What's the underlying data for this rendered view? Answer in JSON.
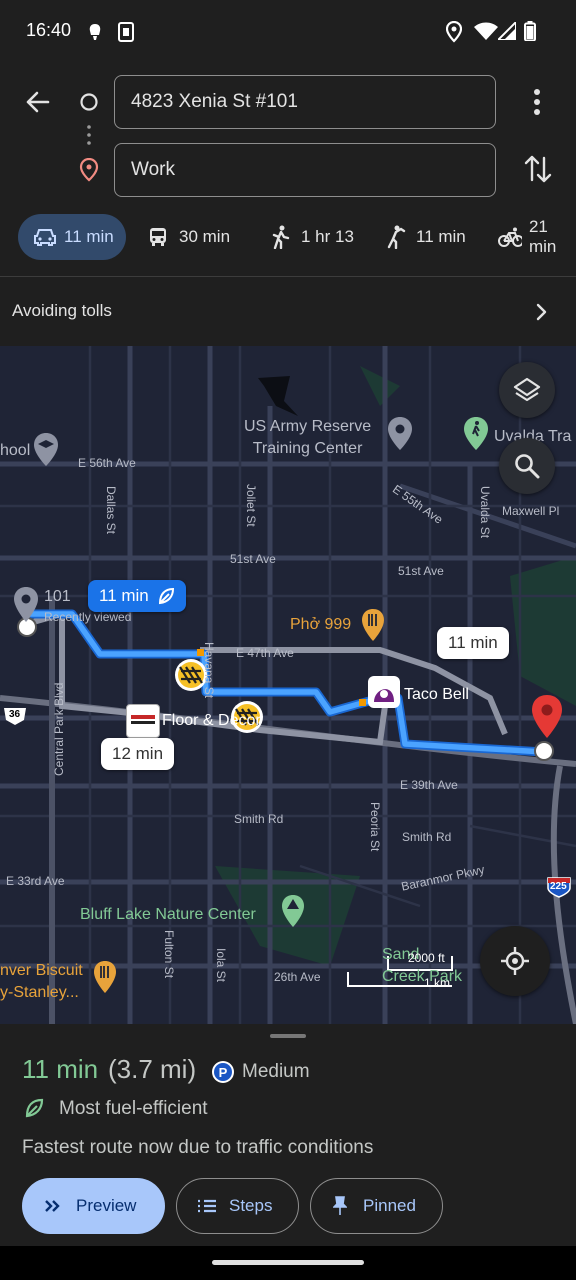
{
  "status": {
    "time": "16:40"
  },
  "directions": {
    "origin": "4823 Xenia St #101",
    "destination": "Work",
    "modes": [
      {
        "name": "drive",
        "label": "11 min"
      },
      {
        "name": "transit",
        "label": "30 min"
      },
      {
        "name": "walk",
        "label": "1 hr 13"
      },
      {
        "name": "rideshare",
        "label": "11 min"
      },
      {
        "name": "bike",
        "label": "21 min"
      }
    ],
    "options": "Avoiding tolls"
  },
  "map": {
    "labels": {
      "army": "US Army Reserve\nTraining Center",
      "uvalda": "Uvalda Tra",
      "school": "hool",
      "e56": "E 56th Ave",
      "dallas": "Dallas St",
      "joliet": "Joliet St",
      "e55": "E 55th Ave",
      "maxwell": "Maxwell Pl",
      "uvalda_st": "Uvalda St",
      "ave51_a": "51st Ave",
      "ave51_b": "51st Ave",
      "num101": "101",
      "recently": "Recently viewed",
      "pho": "Phở 999",
      "e47": "E 47th Ave",
      "havana": "Havana St",
      "tacobell": "Taco Bell",
      "floor": "Floor & Decor",
      "central": "Central Park Blvd",
      "hwy36": "36",
      "e39": "E 39th Ave",
      "smith1": "Smith Rd",
      "smith2": "Smith Rd",
      "peoria": "Peoria St",
      "barnmor": "Baranmor Pkwy",
      "e33": "E 33rd Ave",
      "i225": "225",
      "bluff": "Bluff Lake Nature Center",
      "fulton": "Fulton St",
      "iola": "Iola St",
      "ave26": "26th Ave",
      "biscuit": "nver Biscuit\ny-Stanley...",
      "sand": "Sand\nCreek Park"
    },
    "bubbles": {
      "selected": "11 min",
      "alt1": "11 min",
      "alt2": "12 min"
    },
    "scale": {
      "imperial": "2000 ft",
      "metric": "1 km"
    }
  },
  "summary": {
    "time": "11 min",
    "distance": "(3.7 mi)",
    "parking": "Medium",
    "fuel": "Most fuel-efficient",
    "note": "Fastest route now due to traffic conditions"
  },
  "actions": {
    "preview": "Preview",
    "steps": "Steps",
    "pinned": "Pinned"
  },
  "colors": {
    "route": "#4ba3ff",
    "route_alt": "#8e93a3",
    "accent": "#a8c7fa",
    "green": "#82c995"
  }
}
